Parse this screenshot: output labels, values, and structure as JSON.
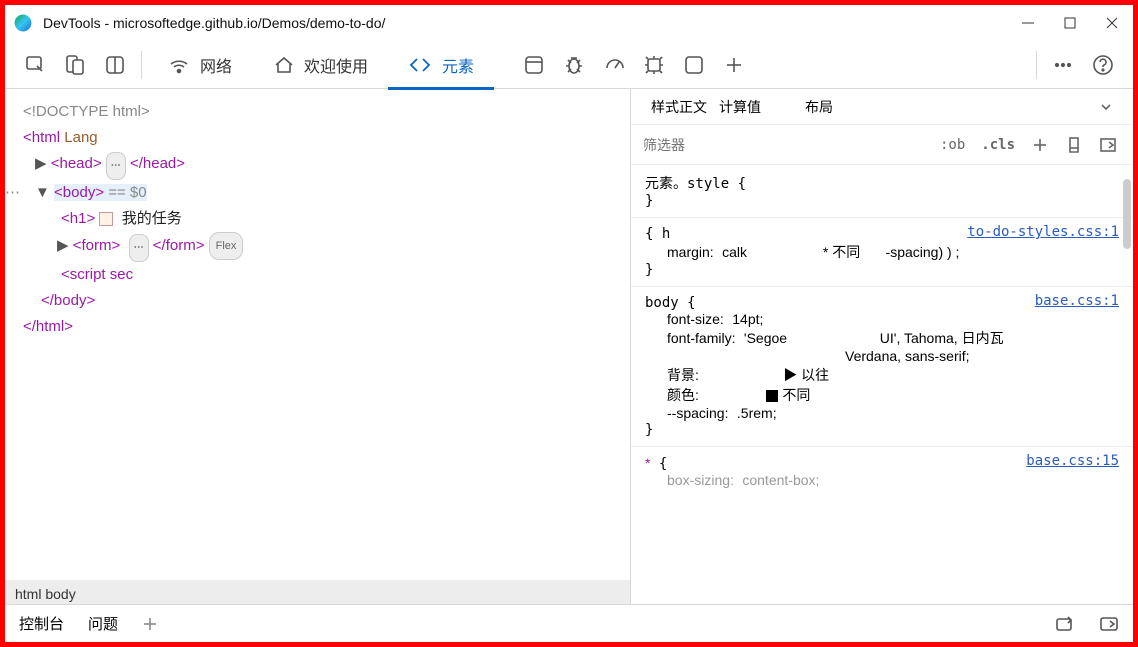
{
  "window": {
    "title": "DevTools - microsoftedge.github.io/Demos/demo-to-do/"
  },
  "main_tabs": {
    "network": "网络",
    "welcome": "欢迎使用",
    "elements": "元素"
  },
  "dom": {
    "doctype": "<!DOCTYPE html>",
    "html_open": "<html",
    "lang_attr": "Lang",
    "head_open": "<head>",
    "head_close": "</head>",
    "body_open": "<body>",
    "body_marker": "== $0",
    "h1_open": "<h1>",
    "h1_text": "我的任务",
    "form_open": "<form>",
    "form_close": "</form>",
    "form_badge": "Flex",
    "script": "<script sec",
    "body_close": "</body>",
    "html_close": "</html>"
  },
  "crumbs": "html body",
  "side_tabs": {
    "styles": "样式正文",
    "computed": "计算值",
    "layout": "布局"
  },
  "filter": {
    "placeholder": "筛选器",
    "hov": ":ob",
    "cls": ".cls"
  },
  "styles": {
    "rule1": {
      "selector": "元素。style {",
      "close": "}"
    },
    "rule2": {
      "link": "to-do-styles.css:1",
      "open": "{ h",
      "margin_prop": "margin:",
      "margin_val1": "calk",
      "margin_mid": "* 不同",
      "margin_val2": "-spacing) ) ;",
      "close": "}"
    },
    "rule3": {
      "link": "base.css:1",
      "selector": "body {",
      "fs_prop": "font-size:",
      "fs_val": "14pt;",
      "ff_prop": "font-family:",
      "ff_val1": "'Segoe",
      "ff_val2": "UI',   Tahoma,    日内瓦",
      "ff_val3": "Verdana,  sans-serif;",
      "bg_prop": "背景:",
      "bg_val": "▶  以往",
      "color_prop": "颜色:",
      "color_val": "不同",
      "spacing_prop": "--spacing:",
      "spacing_val": ".5rem;",
      "close": "}"
    },
    "rule4": {
      "link": "base.css:15",
      "selector": "* {",
      "bs_prop": "box-sizing:",
      "bs_val": "content-box;"
    }
  },
  "drawer": {
    "console": "控制台",
    "issues": "问题"
  }
}
